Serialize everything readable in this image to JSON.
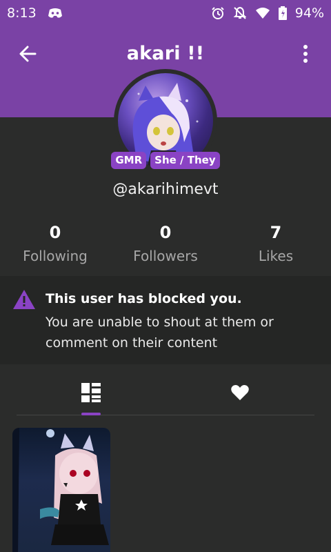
{
  "status_bar": {
    "time": "8:13",
    "battery_percent": "94%",
    "icons": [
      "discord-icon",
      "alarm-icon",
      "notifications-off-icon",
      "wifi-icon",
      "battery-icon"
    ]
  },
  "header": {
    "title": "akari !!",
    "back_icon": "arrow-back-icon",
    "more_icon": "more-vert-icon",
    "color": "#7a42a5"
  },
  "profile": {
    "badges": [
      "GMR",
      "She / They"
    ],
    "handle": "@akarihimevt",
    "badge_color": "#8a43c4"
  },
  "stats": [
    {
      "value": "0",
      "label": "Following"
    },
    {
      "value": "0",
      "label": "Followers"
    },
    {
      "value": "7",
      "label": "Likes"
    }
  ],
  "blocked_notice": {
    "title": "This user has blocked you.",
    "message": "You are unable to shout at them or comment on their content",
    "icon": "warning-icon",
    "icon_color": "#8a43c4"
  },
  "tabs": [
    {
      "name": "posts",
      "icon": "grid-icon",
      "selected": true
    },
    {
      "name": "likes",
      "icon": "heart-icon",
      "selected": false
    }
  ],
  "posts": [
    {
      "kind": "image",
      "description": "cat-eared character artwork"
    }
  ]
}
